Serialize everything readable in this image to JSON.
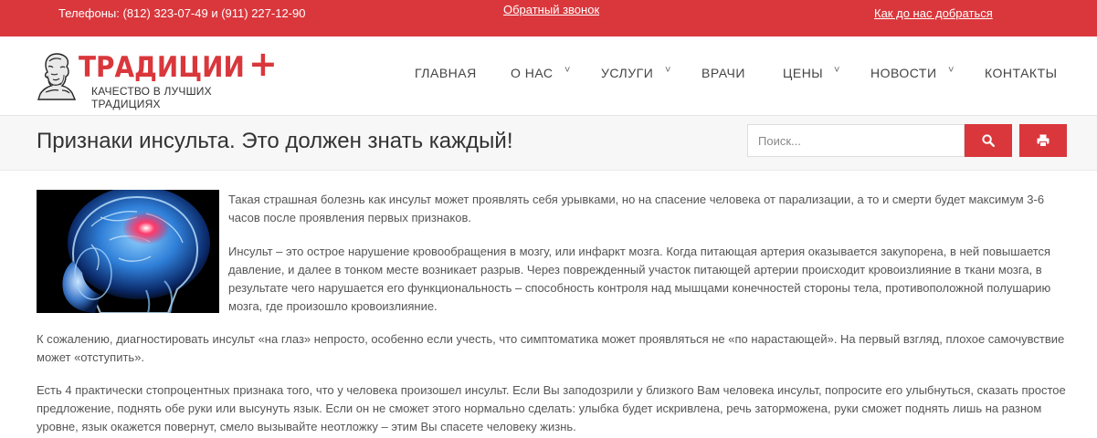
{
  "topbar": {
    "phones": "Телефоны: (812) 323-07-49 и (911) 227-12-90",
    "callback": "Обратный звонок",
    "directions": "Как до нас добраться"
  },
  "logo": {
    "brand": "ТРАДИЦИИ",
    "plus": "+",
    "slogan": "КАЧЕСТВО В ЛУЧШИХ ТРАДИЦИЯХ"
  },
  "nav": {
    "items": [
      {
        "label": "ГЛАВНАЯ",
        "has_dropdown": false
      },
      {
        "label": "О НАС",
        "has_dropdown": true
      },
      {
        "label": "УСЛУГИ",
        "has_dropdown": true
      },
      {
        "label": "ВРАЧИ",
        "has_dropdown": false
      },
      {
        "label": "ЦЕНЫ",
        "has_dropdown": true
      },
      {
        "label": "НОВОСТИ",
        "has_dropdown": true
      },
      {
        "label": "КОНТАКТЫ",
        "has_dropdown": false
      }
    ],
    "chevron": "˅"
  },
  "page": {
    "title": "Признаки инсульта. Это должен знать каждый!"
  },
  "search": {
    "placeholder": "Поиск...",
    "value": ""
  },
  "icons": {
    "search": "search-icon",
    "print": "print-icon"
  },
  "colors": {
    "accent": "#d9373c",
    "text": "#555555",
    "title": "#333333"
  },
  "article": {
    "paragraphs": [
      "Такая страшная болезнь как инсульт может проявлять себя урывками, но на спасение человека от парализации, а то и смерти будет максимум 3-6 часов после проявления первых признаков.",
      "Инсульт – это острое нарушение кровообращения в мозгу, или инфаркт мозга. Когда питающая артерия оказывается закупорена, в ней повышается давление, и далее в тонком месте возникает разрыв. Через поврежденный участок питающей артерии происходит кровоизлияние в ткани мозга, в результате чего нарушается его функциональность – способность контроля над мышцами конечностей стороны тела, противоположной полушарию мозга, где произошло кровоизлияние.",
      "К сожалению, диагностировать инсульт «на глаз» непросто, особенно если учесть, что симптоматика может проявляться не «по нарастающей». На первый взгляд, плохое самочувствие может «отступить».",
      "Есть 4 практически стопроцентных признака того, что у человека произошел инсульт. Если Вы заподозрили у близкого Вам человека инсульт, попросите его улыбнуться, сказать простое предложение, поднять обе руки или высунуть язык. Если он не сможет этого нормально сделать: улыбка будет искривлена, речь заторможена, руки сможет поднять лишь на разном уровне, язык окажется повернут, смело вызывайте неотложку – этим Вы спасете человеку жизнь."
    ]
  }
}
